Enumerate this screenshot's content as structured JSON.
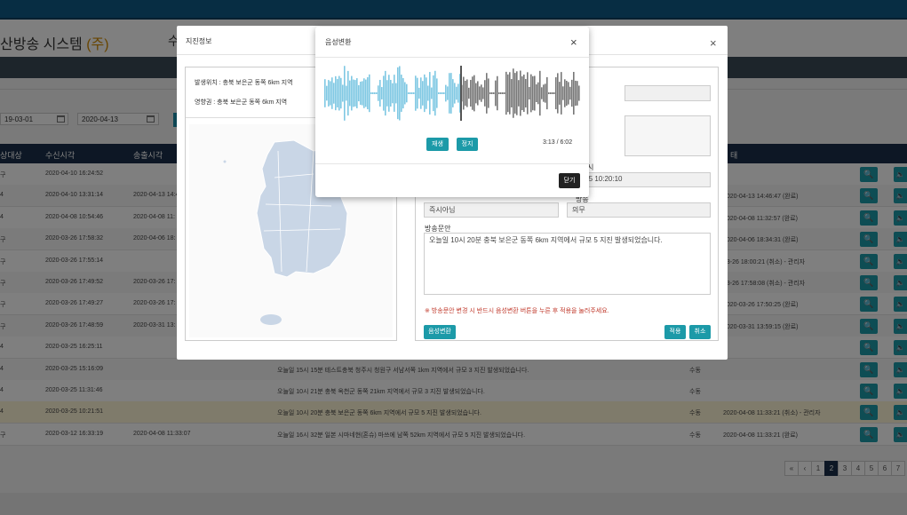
{
  "app": {
    "title": "산방송 시스템",
    "title_suffix": "(주)",
    "header_fragment": "수"
  },
  "filters": {
    "date_from": "19-03-01",
    "date_to": "2020-04-13"
  },
  "table": {
    "headers": [
      "상대상",
      "수신시각",
      "송출시각",
      "태"
    ],
    "rows": [
      {
        "c0": "구",
        "recv": "2020-04-10 16:24:52",
        "send": "",
        "msg": "",
        "mode": "",
        "status": ""
      },
      {
        "c0": "4",
        "recv": "2020-04-10 13:31:14",
        "send": "2020-04-13 14:4",
        "msg": "",
        "mode": "",
        "status": "2020-04-13 14:46:47 (완료)"
      },
      {
        "c0": "4",
        "recv": "2020-04-08 10:54:46",
        "send": "2020-04-08 11:",
        "msg": "",
        "mode": "",
        "status": "2020-04-08 11:32:57 (완료)"
      },
      {
        "c0": "구",
        "recv": "2020-03-26 17:58:32",
        "send": "2020-04-06 18:",
        "msg": "",
        "mode": "",
        "status": "2020-04-06 18:34:31 (완료)"
      },
      {
        "c0": "구",
        "recv": "2020-03-26 17:55:14",
        "send": "",
        "msg": "",
        "mode": "",
        "status": "03-26 18:00:21 (취소) - 관리자"
      },
      {
        "c0": "구",
        "recv": "2020-03-26 17:49:52",
        "send": "2020-03-26 17:",
        "msg": "",
        "mode": "",
        "status": "03-26 17:58:08 (취소) - 관리자"
      },
      {
        "c0": "구",
        "recv": "2020-03-26 17:49:27",
        "send": "2020-03-26 17:",
        "msg": "",
        "mode": "",
        "status": "2020-03-26 17:50:25 (완료)"
      },
      {
        "c0": "구",
        "recv": "2020-03-26 17:48:59",
        "send": "2020-03-31 13:",
        "msg": "",
        "mode": "",
        "status": "2020-03-31 13:59:15 (완료)"
      },
      {
        "c0": "4",
        "recv": "2020-03-25 16:25:11",
        "send": "",
        "msg": "",
        "mode": "",
        "status": ""
      },
      {
        "c0": "4",
        "recv": "2020-03-25 15:16:09",
        "send": "",
        "msg": "오늘일 15시 15분 테스트충북 청주시 청원구 서남서쪽 1km 지역에서 규모 3 지진 발생되었습니다.",
        "mode": "수동",
        "status": ""
      },
      {
        "c0": "4",
        "recv": "2020-03-25 11:31:46",
        "send": "",
        "msg": "오늘일 10시 21분 충북 옥천군 동쪽 21km 지역에서 규모 3 지진 발생되었습니다.",
        "mode": "수동",
        "status": ""
      },
      {
        "c0": "4",
        "recv": "2020-03-25 10:21:51",
        "send": "",
        "msg": "오늘일 10시 20분 충북 보은군 동쪽 6km 지역에서 규모 5 지진 발생되었습니다.",
        "mode": "수동",
        "status": "2020-04-08 11:33:21 (취소) - 관리자"
      },
      {
        "c0": "구",
        "recv": "2020-03-12 16:33:19",
        "send": "2020-04-08 11:33:07",
        "msg": "오늘일 16시 32분 일본 시마네현(혼슈) 마쓰에 남쪽 52km 지역에서 규모 5 지진 발생되었습니다.",
        "mode": "수동",
        "status": "2020-04-08 11:33:21 (완료)"
      }
    ],
    "search_icon": "🔍",
    "speaker_icon": "🔈"
  },
  "pager": {
    "items": [
      "«",
      "‹",
      "1",
      "2",
      "3",
      "4",
      "5",
      "6",
      "7"
    ],
    "active": "2"
  },
  "quake_modal": {
    "title": "지진정보",
    "close": "×",
    "location": "발생위치 : 충북 보은군 동쪽 6km 지역",
    "affected": "영향권 : 충북 보은군 동쪽 6km 지역",
    "datetime_label": "시",
    "datetime_value": "-03-25 10:20:10",
    "field_a_label": "",
    "field_a_value": "즉시아님",
    "field_b_label": "방송",
    "field_b_value": "의무",
    "message_label": "방송문안",
    "message_text": "오늘일 10시 20분 충북 보은군 동쪽 6km 지역에서 규모 5 지진 발생되었습니다.",
    "warning": "※ 방송문안 변경 시 반드시 음성변환 버튼을 누른 후 적용을 눌러주세요.",
    "convert_button": "음성변환",
    "apply_button": "적용",
    "cancel_button": "취소"
  },
  "voice_modal": {
    "title": "음성변환",
    "close": "×",
    "play_button": "재생",
    "stop_button": "정지",
    "time": "3:13 / 6:02",
    "progress": 0.53,
    "close_button": "닫기",
    "played_color": "#7fc8e3",
    "remaining_color": "#777777"
  }
}
